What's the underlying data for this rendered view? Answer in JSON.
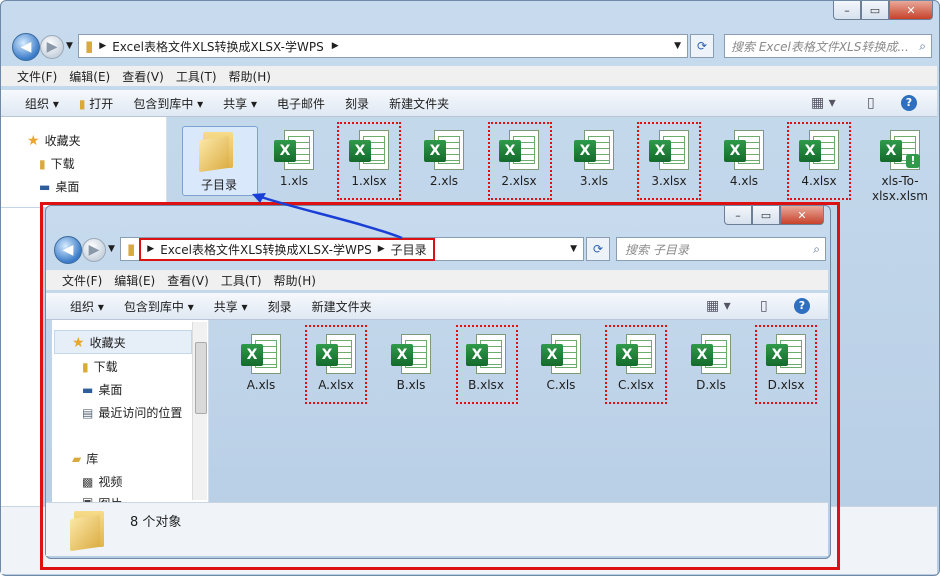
{
  "outer": {
    "address": {
      "path": "Excel表格文件XLS转换成XLSX-学WPS"
    },
    "search": {
      "placeholder": "搜索 Excel表格文件XLS转换成..."
    },
    "menu": [
      "文件(F)",
      "编辑(E)",
      "查看(V)",
      "工具(T)",
      "帮助(H)"
    ],
    "toolbar": [
      "组织",
      "打开",
      "包含到库中",
      "共享",
      "电子邮件",
      "刻录",
      "新建文件夹"
    ],
    "nav": [
      "收藏夹",
      "下载",
      "桌面"
    ],
    "files": [
      "子目录",
      "1.xls",
      "1.xlsx",
      "2.xls",
      "2.xlsx",
      "3.xls",
      "3.xlsx",
      "4.xls",
      "4.xlsx",
      "xls-To-xlsx.xlsm"
    ]
  },
  "inner": {
    "address": {
      "path": "Excel表格文件XLS转换成XLSX-学WPS",
      "sub": "子目录"
    },
    "search": {
      "placeholder": "搜索 子目录"
    },
    "menu": [
      "文件(F)",
      "编辑(E)",
      "查看(V)",
      "工具(T)",
      "帮助(H)"
    ],
    "toolbar": [
      "组织",
      "包含到库中",
      "共享",
      "刻录",
      "新建文件夹"
    ],
    "nav": [
      "收藏夹",
      "下载",
      "桌面",
      "最近访问的位置",
      "库",
      "视频",
      "图片"
    ],
    "files": [
      "A.xls",
      "A.xlsx",
      "B.xls",
      "B.xlsx",
      "C.xls",
      "C.xlsx",
      "D.xls",
      "D.xlsx"
    ],
    "status": "8 个对象"
  },
  "colors": {
    "highlight": "#dd1111",
    "arrow": "#1a3fd6"
  }
}
